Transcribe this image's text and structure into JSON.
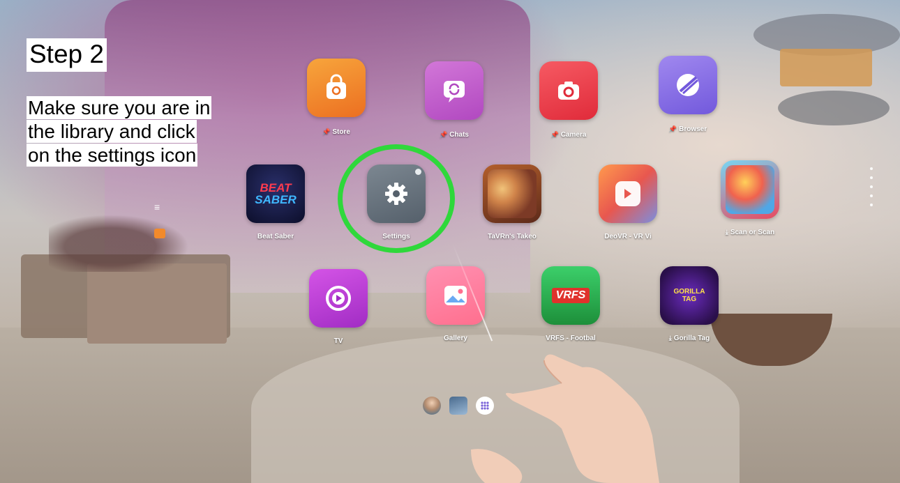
{
  "step": {
    "title": "Step 2"
  },
  "instruction": {
    "lines": [
      "Make sure you are in",
      "the library and click",
      "on the settings icon"
    ]
  },
  "apps": {
    "store": {
      "label": "Store",
      "pinned": true,
      "color": "#f28a2b"
    },
    "chats": {
      "label": "Chats",
      "pinned": true,
      "color": "#c55ccd"
    },
    "camera": {
      "label": "Camera",
      "pinned": true,
      "color": "#ee3f4a"
    },
    "browser": {
      "label": "Browser",
      "pinned": true,
      "color": "#8a6fe6"
    },
    "beat_saber": {
      "label": "Beat Saber",
      "tile_text_1": "BEAT",
      "tile_text_2": "SABER"
    },
    "settings": {
      "label": "Settings"
    },
    "tavrn": {
      "label": "TaVRn's Takeo"
    },
    "deovr": {
      "label": "DeoVR - VR Vi"
    },
    "scan": {
      "label": "Scan or Scan"
    },
    "tv": {
      "label": "TV"
    },
    "gallery": {
      "label": "Gallery"
    },
    "vrfs": {
      "label": "VRFS - Footbal",
      "tile_text": "VRFS"
    },
    "gorilla_tag": {
      "label": "Gorilla Tag",
      "tile_text": "GORILLA TAG"
    }
  },
  "highlight_color": "#2fd83b",
  "icons": {
    "pin": "📌",
    "download": "⤓"
  }
}
